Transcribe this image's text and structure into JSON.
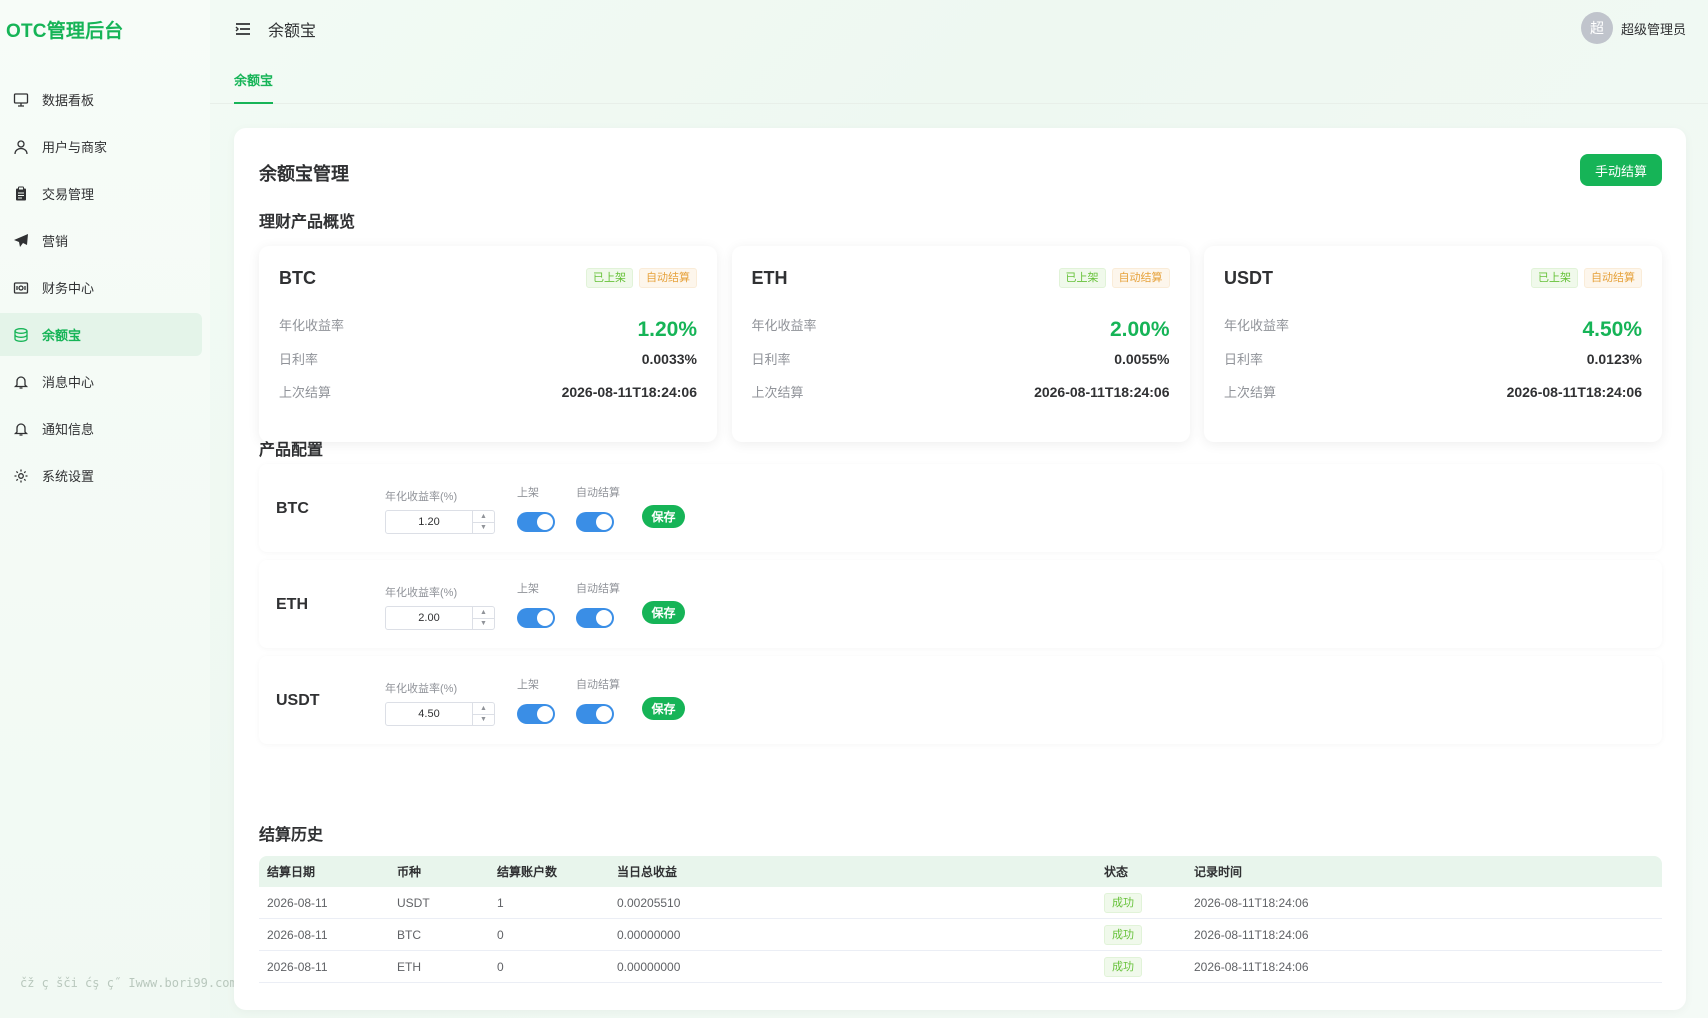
{
  "app": {
    "logo": "OTC管理后台"
  },
  "sidebar": {
    "items": [
      {
        "label": "数据看板",
        "icon": "monitor-icon",
        "active": false
      },
      {
        "label": "用户与商家",
        "icon": "user-icon",
        "active": false
      },
      {
        "label": "交易管理",
        "icon": "clipboard-icon",
        "active": false
      },
      {
        "label": "营销",
        "icon": "paper-plane-icon",
        "active": false
      },
      {
        "label": "财务中心",
        "icon": "wallet-icon",
        "active": false
      },
      {
        "label": "余额宝",
        "icon": "coins-icon",
        "active": true
      },
      {
        "label": "消息中心",
        "icon": "bell-icon",
        "active": false
      },
      {
        "label": "通知信息",
        "icon": "bell-icon",
        "active": false
      },
      {
        "label": "系统设置",
        "icon": "gear-icon",
        "active": false
      }
    ],
    "watermark": "čž ç šči ćş ç˝ Iwww.bori99.com"
  },
  "header": {
    "title": "余额宝",
    "user": {
      "avatar_text": "超",
      "name": "超级管理员"
    }
  },
  "tabs": [
    {
      "label": "余额宝",
      "active": true
    }
  ],
  "main": {
    "title": "余额宝管理",
    "manual_settle_label": "手动结算",
    "overview_title": "理财产品概览",
    "config_title": "产品配置",
    "history_title": "结算历史"
  },
  "overview": [
    {
      "symbol": "BTC",
      "tag_listed": "已上架",
      "tag_auto": "自动结算",
      "apy_label": "年化收益率",
      "apy": "1.20%",
      "daily_label": "日利率",
      "daily": "0.0033%",
      "last_label": "上次结算",
      "last": "2026-08-11T18:24:06"
    },
    {
      "symbol": "ETH",
      "tag_listed": "已上架",
      "tag_auto": "自动结算",
      "apy_label": "年化收益率",
      "apy": "2.00%",
      "daily_label": "日利率",
      "daily": "0.0055%",
      "last_label": "上次结算",
      "last": "2026-08-11T18:24:06"
    },
    {
      "symbol": "USDT",
      "tag_listed": "已上架",
      "tag_auto": "自动结算",
      "apy_label": "年化收益率",
      "apy": "4.50%",
      "daily_label": "日利率",
      "daily": "0.0123%",
      "last_label": "上次结算",
      "last": "2026-08-11T18:24:06"
    }
  ],
  "config": [
    {
      "symbol": "BTC",
      "rate_label": "年化收益率(%)",
      "rate": "1.20",
      "listed_label": "上架",
      "listed": true,
      "auto_label": "自动结算",
      "auto": true,
      "save_label": "保存"
    },
    {
      "symbol": "ETH",
      "rate_label": "年化收益率(%)",
      "rate": "2.00",
      "listed_label": "上架",
      "listed": true,
      "auto_label": "自动结算",
      "auto": true,
      "save_label": "保存"
    },
    {
      "symbol": "USDT",
      "rate_label": "年化收益率(%)",
      "rate": "4.50",
      "listed_label": "上架",
      "listed": true,
      "auto_label": "自动结算",
      "auto": true,
      "save_label": "保存"
    }
  ],
  "history": {
    "columns": [
      "结算日期",
      "币种",
      "结算账户数",
      "当日总收益",
      "状态",
      "记录时间"
    ],
    "rows": [
      {
        "date": "2026-08-11",
        "coin": "USDT",
        "accounts": "1",
        "income": "0.00205510",
        "status": "成功",
        "time": "2026-08-11T18:24:06"
      },
      {
        "date": "2026-08-11",
        "coin": "BTC",
        "accounts": "0",
        "income": "0.00000000",
        "status": "成功",
        "time": "2026-08-11T18:24:06"
      },
      {
        "date": "2026-08-11",
        "coin": "ETH",
        "accounts": "0",
        "income": "0.00000000",
        "status": "成功",
        "time": "2026-08-11T18:24:06"
      }
    ]
  }
}
